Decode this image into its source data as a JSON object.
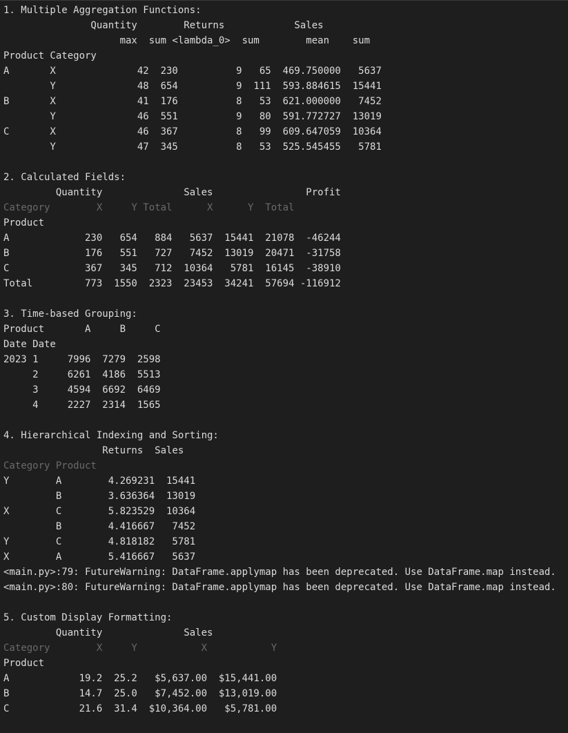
{
  "terminal": {
    "lines": [
      {
        "text": "1. Multiple Aggregation Functions:",
        "dim": false
      },
      {
        "text": "               Quantity        Returns            Sales       ",
        "dim": false
      },
      {
        "text": "                    max  sum <lambda_0>  sum        mean    sum",
        "dim": false
      },
      {
        "text": "Product Category                                              ",
        "dim": false
      },
      {
        "text": "A       X              42  230          9   65  469.750000   5637",
        "dim": false
      },
      {
        "text": "        Y              48  654          9  111  593.884615  15441",
        "dim": false
      },
      {
        "text": "B       X              41  176          8   53  621.000000   7452",
        "dim": false
      },
      {
        "text": "        Y              46  551          9   80  591.772727  13019",
        "dim": false
      },
      {
        "text": "C       X              46  367          8   99  609.647059  10364",
        "dim": false
      },
      {
        "text": "        Y              47  345          8   53  525.545455   5781",
        "dim": false
      },
      {
        "text": "",
        "dim": false
      },
      {
        "text": "2. Calculated Fields:",
        "dim": false
      },
      {
        "text": "         Quantity              Sales                Profit",
        "dim": false
      },
      {
        "text": "Category        X     Y Total      X      Y  Total",
        "dim": true
      },
      {
        "text": "Product",
        "dim": false
      },
      {
        "text": "A             230   654   884   5637  15441  21078  -46244",
        "dim": false
      },
      {
        "text": "B             176   551   727   7452  13019  20471  -31758",
        "dim": false
      },
      {
        "text": "C             367   345   712  10364   5781  16145  -38910",
        "dim": false
      },
      {
        "text": "Total         773  1550  2323  23453  34241  57694 -116912",
        "dim": false
      },
      {
        "text": "",
        "dim": false
      },
      {
        "text": "3. Time-based Grouping:",
        "dim": false
      },
      {
        "text": "Product       A     B     C",
        "dim": false
      },
      {
        "text": "Date Date",
        "dim": false
      },
      {
        "text": "2023 1     7996  7279  2598",
        "dim": false
      },
      {
        "text": "     2     6261  4186  5513",
        "dim": false
      },
      {
        "text": "     3     4594  6692  6469",
        "dim": false
      },
      {
        "text": "     4     2227  2314  1565",
        "dim": false
      },
      {
        "text": "",
        "dim": false
      },
      {
        "text": "4. Hierarchical Indexing and Sorting:",
        "dim": false
      },
      {
        "text": "                 Returns  Sales",
        "dim": false
      },
      {
        "text": "Category Product",
        "dim": true
      },
      {
        "text": "Y        A        4.269231  15441",
        "dim": false
      },
      {
        "text": "         B        3.636364  13019",
        "dim": false
      },
      {
        "text": "X        C        5.823529  10364",
        "dim": false
      },
      {
        "text": "         B        4.416667   7452",
        "dim": false
      },
      {
        "text": "Y        C        4.818182   5781",
        "dim": false
      },
      {
        "text": "X        A        5.416667   5637",
        "dim": false
      },
      {
        "text": "<main.py>:79: FutureWarning: DataFrame.applymap has been deprecated. Use DataFrame.map instead.",
        "dim": false
      },
      {
        "text": "<main.py>:80: FutureWarning: DataFrame.applymap has been deprecated. Use DataFrame.map instead.",
        "dim": false
      },
      {
        "text": "",
        "dim": false
      },
      {
        "text": "5. Custom Display Formatting:",
        "dim": false
      },
      {
        "text": "         Quantity              Sales",
        "dim": false
      },
      {
        "text": "Category        X     Y           X           Y",
        "dim": true
      },
      {
        "text": "Product",
        "dim": false
      },
      {
        "text": "A            19.2  25.2   $5,637.00  $15,441.00",
        "dim": false
      },
      {
        "text": "B            14.7  25.0   $7,452.00  $13,019.00",
        "dim": false
      },
      {
        "text": "C            21.6  31.4  $10,364.00   $5,781.00",
        "dim": false
      }
    ]
  }
}
